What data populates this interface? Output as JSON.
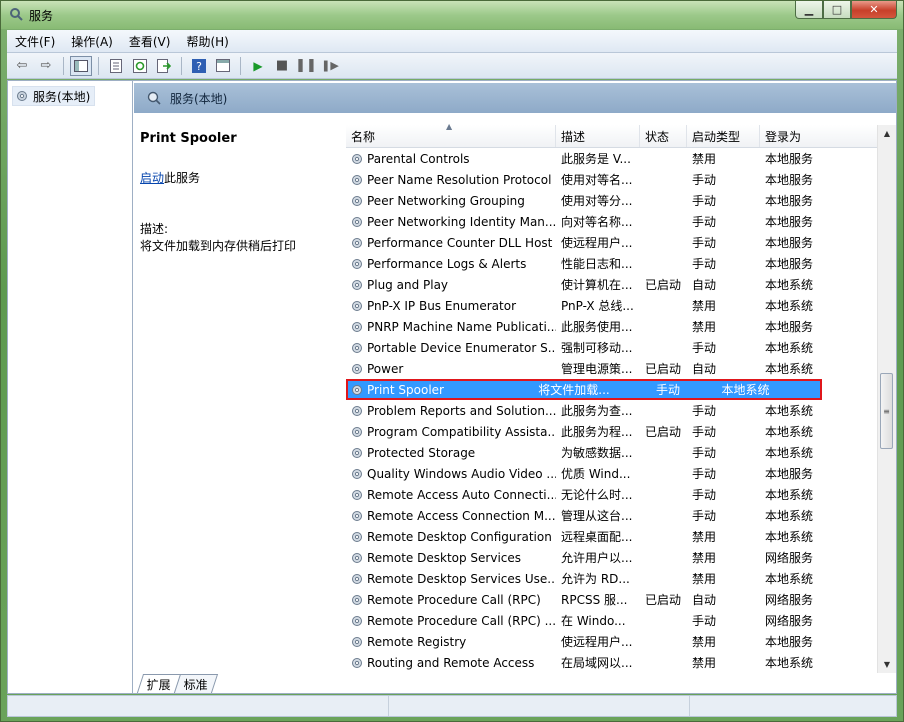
{
  "window": {
    "title": "服务"
  },
  "menu": [
    "文件(F)",
    "操作(A)",
    "查看(V)",
    "帮助(H)"
  ],
  "toolbar": {
    "icons": [
      "back-icon",
      "forward-icon",
      "show-hide-tree-icon",
      "properties-icon",
      "refresh-icon",
      "export-icon",
      "help-icon",
      "view-icon",
      "start-service-icon",
      "stop-service-icon",
      "pause-service-icon",
      "resume-service-icon"
    ]
  },
  "tree": {
    "root_label": "服务(本地)"
  },
  "pane": {
    "header_label": "服务(本地)"
  },
  "detail": {
    "service_name": "Print Spooler",
    "start_link": "启动",
    "start_suffix": "此服务",
    "desc_label": "描述:",
    "desc_text": "将文件加载到内存供稍后打印"
  },
  "columns": {
    "name": "名称",
    "desc": "描述",
    "state": "状态",
    "startup": "启动类型",
    "logon": "登录为"
  },
  "services": [
    {
      "name": "Parental Controls",
      "desc": "此服务是 V...",
      "state": "",
      "startup": "禁用",
      "logon": "本地服务"
    },
    {
      "name": "Peer Name Resolution Protocol",
      "desc": "使用对等名...",
      "state": "",
      "startup": "手动",
      "logon": "本地服务"
    },
    {
      "name": "Peer Networking Grouping",
      "desc": "使用对等分...",
      "state": "",
      "startup": "手动",
      "logon": "本地服务"
    },
    {
      "name": "Peer Networking Identity Man...",
      "desc": "向对等名称...",
      "state": "",
      "startup": "手动",
      "logon": "本地服务"
    },
    {
      "name": "Performance Counter DLL Host",
      "desc": "使远程用户...",
      "state": "",
      "startup": "手动",
      "logon": "本地服务"
    },
    {
      "name": "Performance Logs & Alerts",
      "desc": "性能日志和...",
      "state": "",
      "startup": "手动",
      "logon": "本地服务"
    },
    {
      "name": "Plug and Play",
      "desc": "使计算机在...",
      "state": "已启动",
      "startup": "自动",
      "logon": "本地系统"
    },
    {
      "name": "PnP-X IP Bus Enumerator",
      "desc": "PnP-X 总线...",
      "state": "",
      "startup": "禁用",
      "logon": "本地系统"
    },
    {
      "name": "PNRP Machine Name Publicati...",
      "desc": "此服务使用...",
      "state": "",
      "startup": "禁用",
      "logon": "本地服务"
    },
    {
      "name": "Portable Device Enumerator S...",
      "desc": "强制可移动...",
      "state": "",
      "startup": "手动",
      "logon": "本地系统"
    },
    {
      "name": "Power",
      "desc": "管理电源策...",
      "state": "已启动",
      "startup": "自动",
      "logon": "本地系统"
    },
    {
      "name": "Print Spooler",
      "desc": "将文件加载...",
      "state": "",
      "startup": "手动",
      "logon": "本地系统"
    },
    {
      "name": "Problem Reports and Solution...",
      "desc": "此服务为查...",
      "state": "",
      "startup": "手动",
      "logon": "本地系统"
    },
    {
      "name": "Program Compatibility Assista...",
      "desc": "此服务为程...",
      "state": "已启动",
      "startup": "手动",
      "logon": "本地系统"
    },
    {
      "name": "Protected Storage",
      "desc": "为敏感数据...",
      "state": "",
      "startup": "手动",
      "logon": "本地系统"
    },
    {
      "name": "Quality Windows Audio Video ...",
      "desc": "优质 Wind...",
      "state": "",
      "startup": "手动",
      "logon": "本地服务"
    },
    {
      "name": "Remote Access Auto Connecti...",
      "desc": "无论什么时...",
      "state": "",
      "startup": "手动",
      "logon": "本地系统"
    },
    {
      "name": "Remote Access Connection M...",
      "desc": "管理从这台...",
      "state": "",
      "startup": "手动",
      "logon": "本地系统"
    },
    {
      "name": "Remote Desktop Configuration",
      "desc": "远程桌面配...",
      "state": "",
      "startup": "禁用",
      "logon": "本地系统"
    },
    {
      "name": "Remote Desktop Services",
      "desc": "允许用户以...",
      "state": "",
      "startup": "禁用",
      "logon": "网络服务"
    },
    {
      "name": "Remote Desktop Services Use...",
      "desc": "允许为 RD...",
      "state": "",
      "startup": "禁用",
      "logon": "本地系统"
    },
    {
      "name": "Remote Procedure Call (RPC)",
      "desc": "RPCSS 服...",
      "state": "已启动",
      "startup": "自动",
      "logon": "网络服务"
    },
    {
      "name": "Remote Procedure Call (RPC) ...",
      "desc": "在 Windo...",
      "state": "",
      "startup": "手动",
      "logon": "网络服务"
    },
    {
      "name": "Remote Registry",
      "desc": "使远程用户...",
      "state": "",
      "startup": "禁用",
      "logon": "本地服务"
    },
    {
      "name": "Routing and Remote Access",
      "desc": "在局域网以...",
      "state": "",
      "startup": "禁用",
      "logon": "本地系统"
    }
  ],
  "selected_index": 11,
  "tabs": [
    "扩展",
    "标准"
  ],
  "active_tab": 0,
  "colors": {
    "selection": "#3399ff",
    "highlight_border": "#e0161b",
    "link": "#0645ad"
  }
}
